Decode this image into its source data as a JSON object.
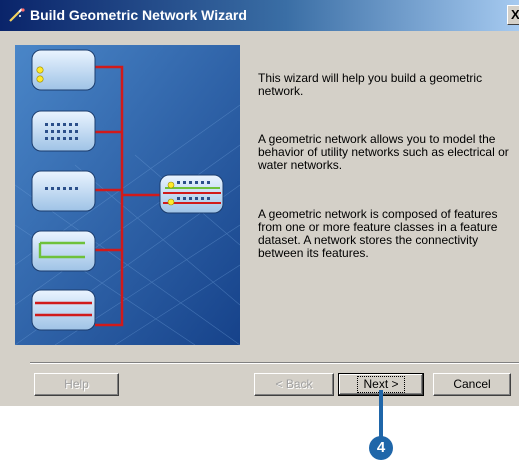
{
  "window": {
    "title": "Build Geometric Network Wizard",
    "close_label": "X"
  },
  "content": {
    "paragraphs": [
      "This wizard will help you build a geometric network.",
      "A geometric network allows you to model the behavior of utility networks such as electrical or water networks.",
      "A geometric network is composed of features from one or more feature classes in a feature dataset. A network stores the connectivity between its features."
    ]
  },
  "buttons": {
    "help": "Help",
    "back": "< Back",
    "next": "Next >",
    "cancel": "Cancel"
  },
  "callout": {
    "number": "4"
  },
  "colors": {
    "title_gradient_start": "#0a246a",
    "dialog_face": "#d4d0c8",
    "illustration_bg": "#2e5fa8",
    "connector_red": "#d11a1a",
    "callout_blue": "#1f66a9"
  }
}
